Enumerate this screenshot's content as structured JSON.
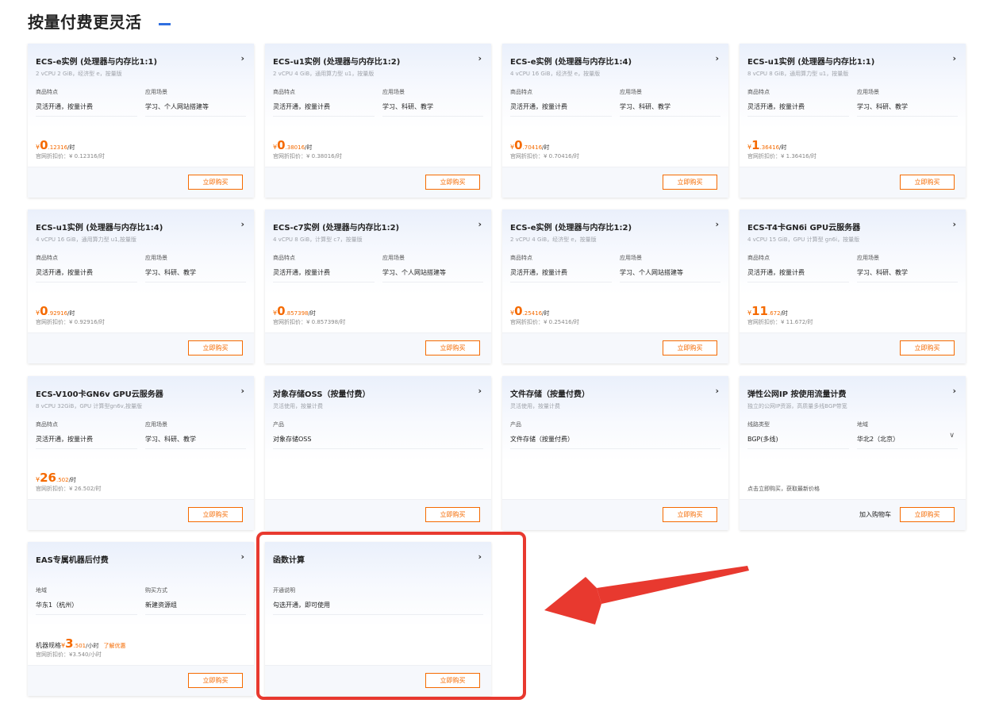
{
  "page": {
    "title": "按量付费更灵活"
  },
  "buy_label": "立即购买",
  "cart_label": "加入购物车",
  "cards": [
    {
      "title": "ECS-e实例 (处理器与内存比1:1)",
      "subtitle": "2 vCPU 2 GiB，经济型 e，按量版",
      "fields": [
        {
          "label": "商品特点",
          "value": "灵活开通，按量计费"
        },
        {
          "label": "应用场景",
          "value": "学习、个人网站搭建等"
        }
      ],
      "price": {
        "yen": "¥",
        "big": "0",
        "small": ".12316",
        "unit": "/时"
      },
      "official": "官网折扣价：¥ 0.12316/时"
    },
    {
      "title": "ECS-u1实例 (处理器与内存比1:2)",
      "subtitle": "2 vCPU 4 GiB，通用算力型 u1，按量版",
      "fields": [
        {
          "label": "商品特点",
          "value": "灵活开通，按量计费"
        },
        {
          "label": "应用场景",
          "value": "学习、科研、教学"
        }
      ],
      "price": {
        "yen": "¥",
        "big": "0",
        "small": ".38016",
        "unit": "/时"
      },
      "official": "官网折扣价：¥ 0.38016/时"
    },
    {
      "title": "ECS-e实例 (处理器与内存比1:4)",
      "subtitle": "4 vCPU 16 GiB，经济型 e，按量版",
      "fields": [
        {
          "label": "商品特点",
          "value": "灵活开通，按量计费"
        },
        {
          "label": "应用场景",
          "value": "学习、科研、教学"
        }
      ],
      "price": {
        "yen": "¥",
        "big": "0",
        "small": ".70416",
        "unit": "/时"
      },
      "official": "官网折扣价：¥ 0.70416/时"
    },
    {
      "title": "ECS-u1实例 (处理器与内存比1:1)",
      "subtitle": "8 vCPU 8 GiB，通用算力型 u1，按量版",
      "fields": [
        {
          "label": "商品特点",
          "value": "灵活开通，按量计费"
        },
        {
          "label": "应用场景",
          "value": "学习、科研、教学"
        }
      ],
      "price": {
        "yen": "¥",
        "big": "1",
        "small": ".36416",
        "unit": "/时"
      },
      "official": "官网折扣价：¥ 1.36416/时"
    },
    {
      "title": "ECS-u1实例 (处理器与内存比1:4)",
      "subtitle": "4 vCPU 16 GiB，通用算力型 u1,按量版",
      "fields": [
        {
          "label": "商品特点",
          "value": "灵活开通，按量计费"
        },
        {
          "label": "应用场景",
          "value": "学习、科研、教学"
        }
      ],
      "price": {
        "yen": "¥",
        "big": "0",
        "small": ".92916",
        "unit": "/时"
      },
      "official": "官网折扣价：¥ 0.92916/时"
    },
    {
      "title": "ECS-c7实例 (处理器与内存比1:2)",
      "subtitle": "4 vCPU 8 GiB，计算型 c7，按量版",
      "fields": [
        {
          "label": "商品特点",
          "value": "灵活开通，按量计费"
        },
        {
          "label": "应用场景",
          "value": "学习、个人网站搭建等"
        }
      ],
      "price": {
        "yen": "¥",
        "big": "0",
        "small": ".857398",
        "unit": "/时"
      },
      "official": "官网折扣价：¥ 0.857398/时"
    },
    {
      "title": "ECS-e实例 (处理器与内存比1:2)",
      "subtitle": "2 vCPU 4 GiB，经济型 e，按量版",
      "fields": [
        {
          "label": "商品特点",
          "value": "灵活开通，按量计费"
        },
        {
          "label": "应用场景",
          "value": "学习、个人网站搭建等"
        }
      ],
      "price": {
        "yen": "¥",
        "big": "0",
        "small": ".25416",
        "unit": "/时"
      },
      "official": "官网折扣价：¥ 0.25416/时"
    },
    {
      "title": "ECS-T4卡GN6i GPU云服务器",
      "subtitle": "4 vCPU 15 GiB，GPU 计算型 gn6i，按量版",
      "fields": [
        {
          "label": "商品特点",
          "value": "灵活开通，按量计费"
        },
        {
          "label": "应用场景",
          "value": "学习、科研、教学"
        }
      ],
      "price": {
        "yen": "¥",
        "big": "11",
        "small": ".672",
        "unit": "/时"
      },
      "official": "官网折扣价：¥ 11.672/时"
    },
    {
      "title": "ECS-V100卡GN6v GPU云服务器",
      "subtitle": "8 vCPU 32GiB，GPU 计算型gn6v,按量版",
      "fields": [
        {
          "label": "商品特点",
          "value": "灵活开通，按量计费"
        },
        {
          "label": "应用场景",
          "value": "学习、科研、教学"
        }
      ],
      "price": {
        "yen": "¥",
        "big": "26",
        "small": ".502",
        "unit": "/时"
      },
      "official": "官网折扣价：¥ 26.502/时"
    },
    {
      "title": "对象存储OSS（按量付费）",
      "subtitle": "灵活使用，按量计费",
      "fields": [
        {
          "label": "产品",
          "value": "对象存储OSS"
        }
      ]
    },
    {
      "title": "文件存储（按量付费）",
      "subtitle": "灵活使用，按量计费",
      "fields": [
        {
          "label": "产品",
          "value": "文件存储（按量付费）"
        }
      ]
    },
    {
      "title": "弹性公网IP 按使用流量计费",
      "subtitle": "独立的公网IP资源，高质量多线BGP带宽",
      "fields": [
        {
          "label": "线路类型",
          "value": "BGP(多线)"
        },
        {
          "label": "地域",
          "value": "华北2（北京）"
        }
      ],
      "note": "点击立即购买，获取最新价格"
    },
    {
      "title": "EAS专属机器后付费",
      "subtitle": "",
      "fields": [
        {
          "label": "地域",
          "value": "华东1（杭州）"
        },
        {
          "label": "购买方式",
          "value": "新建资源组"
        }
      ],
      "price": {
        "prefix": "机器规格",
        "yen": "¥",
        "big": "3",
        "small": ".501",
        "unit": "/小时",
        "promo": "了解优惠"
      },
      "official": "官网折扣价：¥3.540/小时"
    },
    {
      "title": "函数计算",
      "subtitle": "",
      "fields": [
        {
          "label": "开通说明",
          "value": "勾选开通，即可使用"
        }
      ]
    }
  ]
}
